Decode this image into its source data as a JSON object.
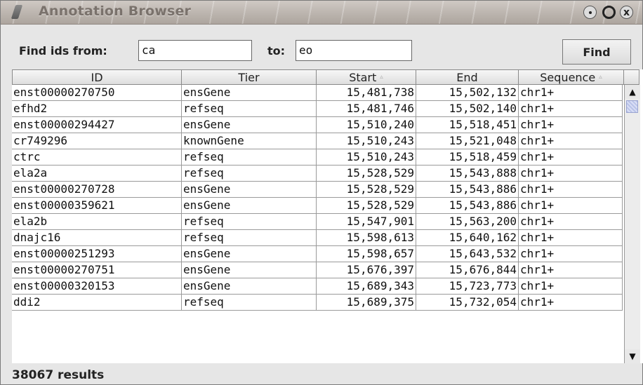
{
  "window": {
    "title": "Annotation Browser",
    "controls": {
      "minimize": "·",
      "maximize": "○",
      "close": "x"
    }
  },
  "search": {
    "from_label": "Find ids from:",
    "from_value": "ca",
    "to_label": "to:",
    "to_value": "eo",
    "find_label": "Find"
  },
  "table": {
    "headers": [
      "ID",
      "Tier",
      "Start",
      "End",
      "Sequence"
    ],
    "sort_indicator": "▵",
    "rows": [
      [
        "enst00000270750",
        "ensGene",
        "15,481,738",
        "15,502,132",
        "chr1+"
      ],
      [
        "efhd2",
        "refseq",
        "15,481,746",
        "15,502,140",
        "chr1+"
      ],
      [
        "enst00000294427",
        "ensGene",
        "15,510,240",
        "15,518,451",
        "chr1+"
      ],
      [
        "cr749296",
        "knownGene",
        "15,510,243",
        "15,521,048",
        "chr1+"
      ],
      [
        "ctrc",
        "refseq",
        "15,510,243",
        "15,518,459",
        "chr1+"
      ],
      [
        "ela2a",
        "refseq",
        "15,528,529",
        "15,543,888",
        "chr1+"
      ],
      [
        "enst00000270728",
        "ensGene",
        "15,528,529",
        "15,543,886",
        "chr1+"
      ],
      [
        "enst00000359621",
        "ensGene",
        "15,528,529",
        "15,543,886",
        "chr1+"
      ],
      [
        "ela2b",
        "refseq",
        "15,547,901",
        "15,563,200",
        "chr1+"
      ],
      [
        "dnajc16",
        "refseq",
        "15,598,613",
        "15,640,162",
        "chr1+"
      ],
      [
        "enst00000251293",
        "ensGene",
        "15,598,657",
        "15,643,532",
        "chr1+"
      ],
      [
        "enst00000270751",
        "ensGene",
        "15,676,397",
        "15,676,844",
        "chr1+"
      ],
      [
        "enst00000320153",
        "ensGene",
        "15,689,343",
        "15,723,773",
        "chr1+"
      ],
      [
        "ddi2",
        "refseq",
        "15,689,375",
        "15,732,054",
        "chr1+"
      ]
    ]
  },
  "status": {
    "text": "38067 results"
  }
}
